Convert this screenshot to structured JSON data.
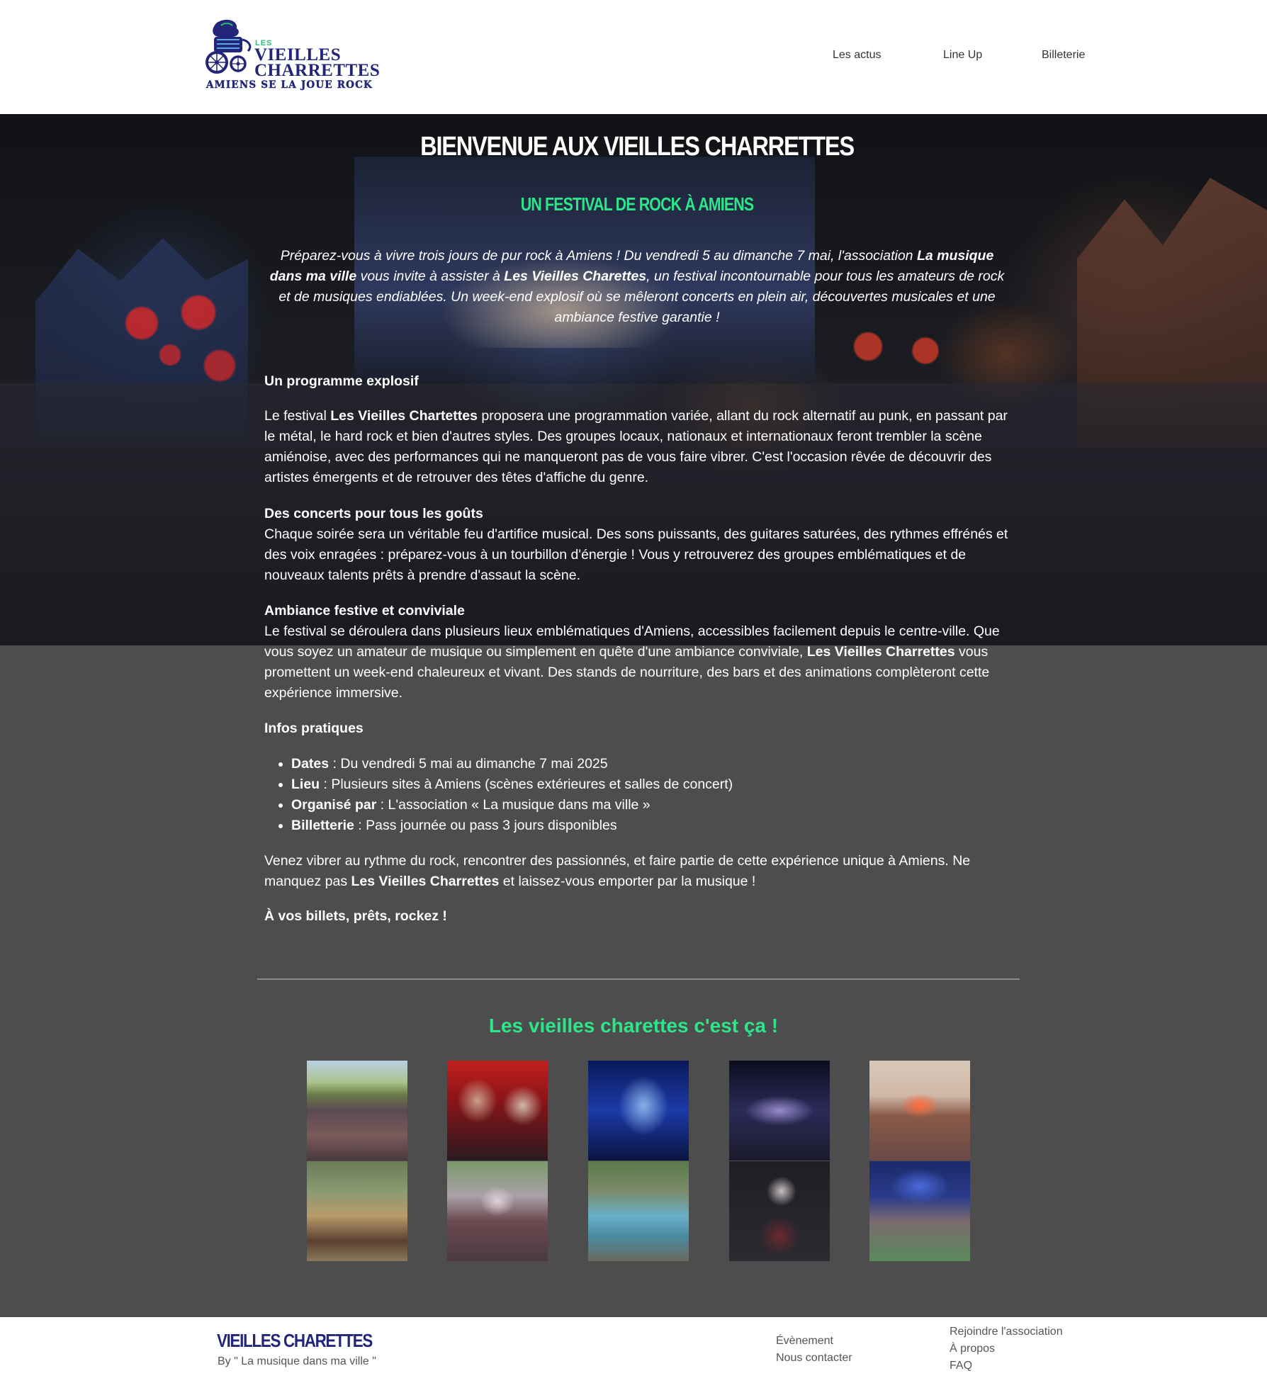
{
  "header": {
    "logo": {
      "small": "LES",
      "line1": "VIEILLES",
      "line2": "CHARRETTES",
      "tagline": "AMIENS SE LA JOUE ROCK"
    },
    "nav": [
      "Les actus",
      "Line Up",
      "Billeterie"
    ]
  },
  "hero": {
    "title": "BIENVENUE AUX VIEILLES CHARRETTES",
    "subtitle": "UN FESTIVAL DE ROCK À AMIENS",
    "intro": {
      "p1": "Préparez-vous à vivre trois jours de pur rock à Amiens ! Du vendredi 5 au dimanche 7 mai, l'association ",
      "b1": "La musique dans ma ville",
      "p2": " vous invite à assister à ",
      "b2": "Les Vieilles Charettes",
      "p3": ", un festival incontournable pour tous les amateurs de rock et de musiques endiablées. Un week-end explosif où se mêleront concerts en plein air, découvertes musicales et une ambiance festive garantie !"
    }
  },
  "sections": {
    "programme": {
      "heading": "Un programme explosif",
      "p1": "Le festival ",
      "b1": "Les Vieilles Chartettes",
      "p2": " proposera une programmation variée, allant du rock alternatif au punk, en passant par le métal, le hard rock et bien d'autres styles. Des groupes locaux, nationaux et internationaux feront trembler la scène amiénoise, avec des performances qui ne manqueront pas de vous faire vibrer. C'est l'occasion rêvée de découvrir des artistes émergents et de retrouver des têtes d'affiche du genre."
    },
    "concerts": {
      "heading": "Des concerts pour tous les goûts",
      "text": "Chaque soirée sera un véritable feu d'artifice musical. Des sons puissants, des guitares saturées, des rythmes effrénés et des voix enragées : préparez-vous à un tourbillon d'énergie ! Vous y retrouverez des groupes emblématiques et de nouveaux talents prêts à prendre d'assaut la scène."
    },
    "ambiance": {
      "heading": "Ambiance festive et conviviale",
      "p1": "Le festival se déroulera dans plusieurs lieux emblématiques d'Amiens, accessibles facilement depuis le centre-ville. Que vous soyez un amateur de musique ou simplement en quête d'une ambiance conviviale, ",
      "b1": "Les Vieilles Charrettes",
      "p2": " vous promettent un week-end chaleureux et vivant. Des stands de nourriture, des bars et des animations complèteront cette expérience immersive."
    },
    "infos": {
      "heading": "Infos pratiques",
      "items": [
        {
          "label": "Dates",
          "value": " : Du vendredi 5 mai au dimanche 7 mai 2025"
        },
        {
          "label": "Lieu",
          "value": " : Plusieurs sites à Amiens (scènes extérieures et salles de concert)"
        },
        {
          "label": "Organisé par",
          "value": " : L'association « La musique dans ma ville »"
        },
        {
          "label": "Billetterie",
          "value": " : Pass journée ou pass 3 jours disponibles"
        }
      ]
    },
    "closing": {
      "p1": "Venez vibrer au rythme du rock, rencontrer des passionnés, et faire partie de cette expérience unique à Amiens. Ne manquez pas ",
      "b1": "Les Vieilles Charrettes",
      "p2": " et laissez-vous emporter par la musique !",
      "final": "À vos billets, prêts, rockez !"
    }
  },
  "gallery": {
    "title": "Les vieilles charettes c'est ça !",
    "photos": [
      "photo-crowd",
      "photo-violinist",
      "photo-guitarist-blue",
      "photo-stage-night",
      "photo-stage-sunset",
      "photo-food-stand",
      "photo-stage-crowd",
      "photo-vintage-car",
      "photo-guitarist-dark",
      "photo-audience"
    ]
  },
  "footer": {
    "brand": "VIEILLES CHARETTES",
    "by": "By \" La musique dans ma ville \"",
    "links_col1": [
      "Évènement",
      "Nous contacter"
    ],
    "links_col2": [
      "Rejoindre l'association",
      "À propos",
      "FAQ"
    ]
  },
  "colors": {
    "accent_green": "#2ee68a",
    "brand_navy": "#23257a",
    "body_bg": "#4d4d4d"
  }
}
